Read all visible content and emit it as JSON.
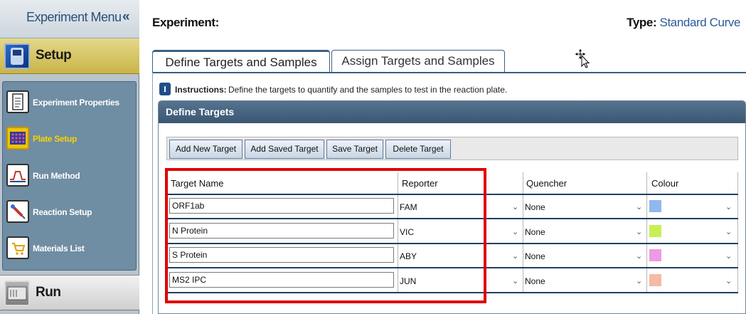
{
  "sidebar": {
    "menu_title": "Experiment Menu",
    "collapse_glyph": "«",
    "setup_label": "Setup",
    "run_label": "Run",
    "items": [
      {
        "label": "Experiment Properties",
        "icon": "checklist-icon",
        "active": false
      },
      {
        "label": "Plate Setup",
        "icon": "plate-grid-icon",
        "active": true
      },
      {
        "label": "Run Method",
        "icon": "run-curve-icon",
        "active": false
      },
      {
        "label": "Reaction Setup",
        "icon": "pipette-icon",
        "active": false
      },
      {
        "label": "Materials List",
        "icon": "cart-icon",
        "active": false
      }
    ]
  },
  "header": {
    "experiment_label": "Experiment:",
    "type_label": "Type:",
    "type_value": "Standard Curve"
  },
  "tabs": [
    {
      "label": "Define Targets and Samples",
      "active": true
    },
    {
      "label": "Assign Targets and Samples",
      "active": false
    }
  ],
  "instructions": {
    "icon_glyph": "I",
    "label": "Instructions:",
    "text": "Define the targets to quantify and the samples to test in the reaction plate."
  },
  "panel": {
    "title": "Define Targets",
    "buttons": [
      "Add New Target",
      "Add Saved Target",
      "Save Target",
      "Delete Target"
    ]
  },
  "table": {
    "columns": [
      "Target Name",
      "Reporter",
      "Quencher",
      "Colour"
    ],
    "rows": [
      {
        "name": "ORF1ab",
        "reporter": "FAM",
        "quencher": "None",
        "colour": "#8fb8ee"
      },
      {
        "name": "N Protein",
        "reporter": "VIC",
        "quencher": "None",
        "colour": "#c8ef55"
      },
      {
        "name": "S Protein",
        "reporter": "ABY",
        "quencher": "None",
        "colour": "#ee9ae4"
      },
      {
        "name": "MS2 IPC",
        "reporter": "JUN",
        "quencher": "None",
        "colour": "#f5b9a4"
      }
    ]
  },
  "colors": {
    "highlight_box": "#e00000",
    "accent_blue": "#2c5a9a",
    "setup_gold": "#c9b548"
  }
}
